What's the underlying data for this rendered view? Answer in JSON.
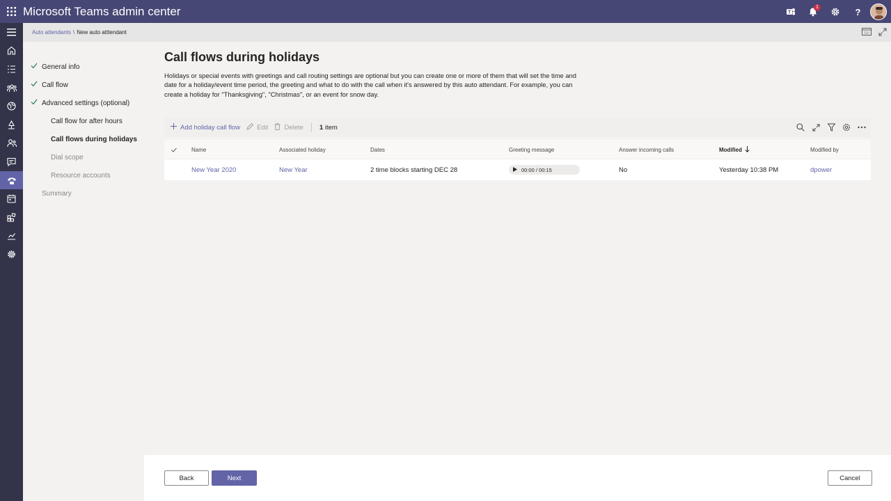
{
  "app": {
    "title": "Microsoft Teams admin center",
    "notification_count": "1"
  },
  "breadcrumb": {
    "parent": "Auto attendants",
    "separator": "\\",
    "current": "New auto atttendant"
  },
  "wizard": {
    "steps": [
      {
        "label": "General info",
        "done": true
      },
      {
        "label": "Call flow",
        "done": true
      },
      {
        "label": "Advanced settings (optional)",
        "done": true
      },
      {
        "label": "Call flow for after hours",
        "done": false
      },
      {
        "label": "Call flows during holidays",
        "done": false,
        "current": true
      },
      {
        "label": "Dial scope",
        "done": false
      },
      {
        "label": "Resource accounts",
        "done": false
      },
      {
        "label": "Summary",
        "done": false
      }
    ]
  },
  "page": {
    "title": "Call flows during holidays",
    "description": "Holidays or special events with greetings and call routing settings are optional but you can create one or more of them that will set the time and date for a holiday/event time period, the greeting and what to do with the call when it's answered by this auto attendant. For example, you can create a holiday for \"Thanksgiving\", \"Christmas\", or an event for snow day."
  },
  "toolbar": {
    "add_label": "Add holiday call flow",
    "edit_label": "Edit",
    "delete_label": "Delete",
    "count_number": "1",
    "count_suffix": "item"
  },
  "table": {
    "columns": {
      "name": "Name",
      "holiday": "Associated holiday",
      "dates": "Dates",
      "greeting": "Greeting message",
      "answer": "Answer incoming calls",
      "modified": "Modified",
      "modified_by": "Modified by"
    },
    "rows": [
      {
        "name": "New Year 2020",
        "holiday": "New Year",
        "dates": "2 time blocks starting DEC 28",
        "greeting": "00:00 / 00:15",
        "answer": "No",
        "modified": "Yesterday 10:38 PM",
        "modified_by": "dpower"
      }
    ]
  },
  "footer": {
    "back_label": "Back",
    "next_label": "Next",
    "cancel_label": "Cancel"
  },
  "colors": {
    "brand": "#464775",
    "accent": "#6264a7",
    "rail": "#33344a",
    "badge": "#c4314b"
  }
}
